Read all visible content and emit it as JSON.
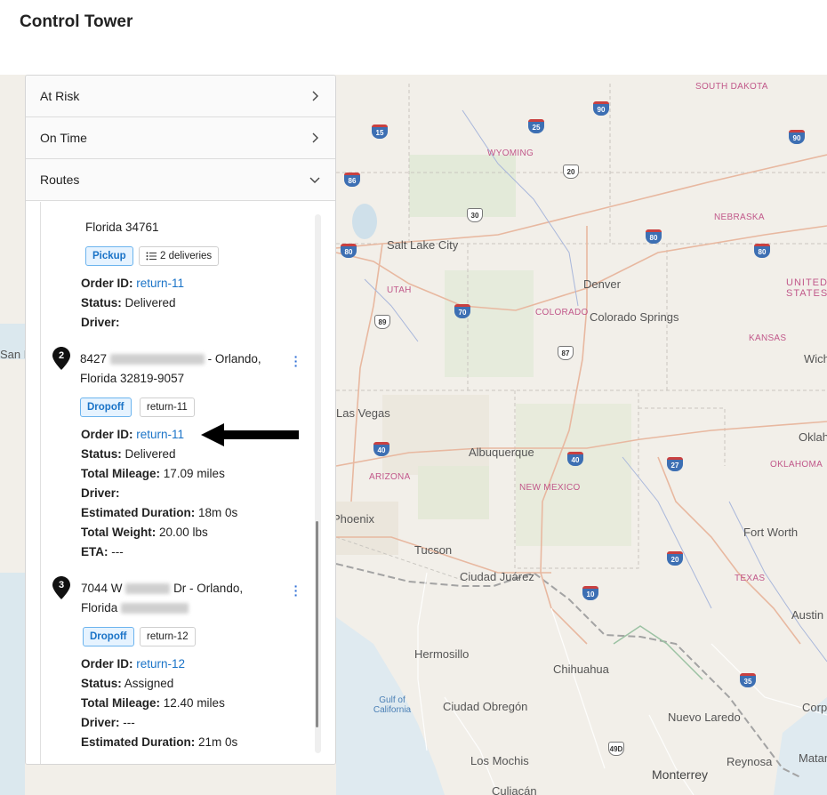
{
  "header": {
    "title": "Control Tower"
  },
  "accordion": [
    {
      "label": "At Risk",
      "state": "collapsed"
    },
    {
      "label": "On Time",
      "state": "collapsed"
    },
    {
      "label": "Routes",
      "state": "expanded"
    }
  ],
  "stops": {
    "stop1": {
      "address_tail": "Florida 34761",
      "type_tag": "Pickup",
      "deliveries_tag": "2 deliveries",
      "order_id_label": "Order ID:",
      "order_id": "return-11",
      "status_label": "Status:",
      "status": "Delivered",
      "driver_label": "Driver:"
    },
    "stop2": {
      "number": "2",
      "address_line1_prefix": "8427",
      "address_line1_suffix": "- Orlando,",
      "address_line2": "Florida 32819-9057",
      "type_tag": "Dropoff",
      "order_tag": "return-11",
      "order_id_label": "Order ID:",
      "order_id": "return-11",
      "status_label": "Status:",
      "status": "Delivered",
      "mileage_label": "Total Mileage:",
      "mileage": "17.09 miles",
      "driver_label": "Driver:",
      "duration_label": "Estimated Duration:",
      "duration": "18m 0s",
      "weight_label": "Total Weight:",
      "weight": "20.00 lbs",
      "eta_label": "ETA:",
      "eta": "---"
    },
    "stop3": {
      "number": "3",
      "address_line1_prefix": "7044 W",
      "address_line1_suffix": "Dr - Orlando,",
      "address_line2_prefix": "Florida",
      "type_tag": "Dropoff",
      "order_tag": "return-12",
      "order_id_label": "Order ID:",
      "order_id": "return-12",
      "status_label": "Status:",
      "status": "Assigned",
      "mileage_label": "Total Mileage:",
      "mileage": "12.40 miles",
      "driver_label": "Driver:",
      "driver": "---",
      "duration_label": "Estimated Duration:",
      "duration": "21m 0s"
    }
  },
  "map": {
    "states": [
      "SOUTH DAKOTA",
      "WYOMING",
      "NEBRASKA",
      "UTAH",
      "COLORADO",
      "KANSAS",
      "ARIZONA",
      "NEW MEXICO",
      "OKLAHOMA",
      "TEXAS",
      "UNITED STATES"
    ],
    "cities": [
      "Salt Lake City",
      "Denver",
      "Colorado Springs",
      "Albuquerque",
      "Phoenix",
      "Tucson",
      "Ciudad Juárez",
      "Hermosillo",
      "Chihuahua",
      "Ciudad Obregón",
      "Los Mochis",
      "Culiacán",
      "Monterrey",
      "Reynosa",
      "Nuevo Laredo",
      "Fort Worth",
      "Austin",
      "Oklahoma",
      "Wichita",
      "Las Vegas",
      "San Francisco",
      "Corpus Christi",
      "Matamoros"
    ],
    "water": [
      "Gulf of California"
    ],
    "shields": [
      "15",
      "25",
      "90",
      "90",
      "86",
      "20",
      "30",
      "80",
      "80",
      "80",
      "89",
      "70",
      "87",
      "40",
      "40",
      "27",
      "20",
      "10",
      "35",
      "49D"
    ]
  }
}
